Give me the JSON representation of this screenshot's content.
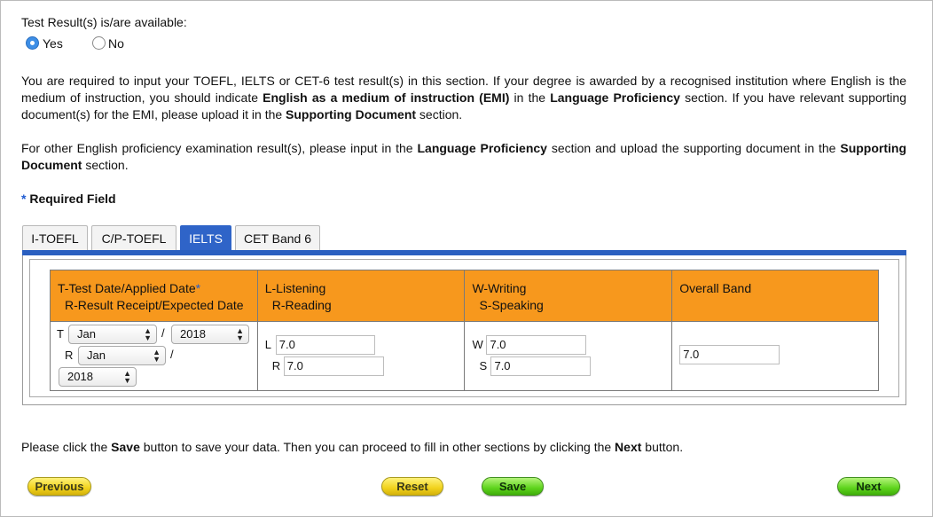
{
  "test_result": {
    "question": "Test Result(s) is/are available:",
    "options": [
      {
        "label": "Yes",
        "checked": true
      },
      {
        "label": "No",
        "checked": false
      }
    ]
  },
  "instructions": {
    "p1": [
      {
        "text": "You are required to input your TOEFL, IELTS or CET-6 test result(s) in this section. If your degree is awarded by a recognised institution where English is the medium of instruction, you should indicate ",
        "bold": false
      },
      {
        "text": "English as a medium of instruction (EMI)",
        "bold": true
      },
      {
        "text": " in the ",
        "bold": false
      },
      {
        "text": "Language Proficiency",
        "bold": true
      },
      {
        "text": " section. If you have relevant supporting document(s) for the EMI, please upload it in the ",
        "bold": false
      },
      {
        "text": "Supporting Document",
        "bold": true
      },
      {
        "text": " section.",
        "bold": false
      }
    ],
    "p2": [
      {
        "text": "For other English proficiency examination result(s), please input in the ",
        "bold": false
      },
      {
        "text": "Language Proficiency",
        "bold": true
      },
      {
        "text": " section and upload the supporting document in the ",
        "bold": false
      },
      {
        "text": "Supporting Document",
        "bold": true
      },
      {
        "text": " section.",
        "bold": false
      }
    ]
  },
  "required": {
    "star": "*",
    "label": "Required Field"
  },
  "tabs": [
    {
      "label": "I-TOEFL",
      "active": false
    },
    {
      "label": "C/P-TOEFL",
      "active": false
    },
    {
      "label": "IELTS",
      "active": true
    },
    {
      "label": "CET Band 6",
      "active": false
    }
  ],
  "table": {
    "headers": {
      "date": {
        "line1": "T-Test Date/Applied Date",
        "star": "*",
        "line2": "R-Result Receipt/Expected Date"
      },
      "lr": {
        "line1": "L-Listening",
        "line2": "R-Reading"
      },
      "ws": {
        "line1": "W-Writing",
        "line2": "S-Speaking"
      },
      "overall": {
        "line1": "Overall Band"
      }
    },
    "row": {
      "t_label": "T",
      "t_month": "Jan",
      "sep1": "/",
      "t_year": "2018",
      "r_label": "R",
      "r_month": "Jan",
      "sep2": "/",
      "r_year": "2018",
      "l_label": "L",
      "l_value": "7.0",
      "r2_label": "R",
      "r_value": "7.0",
      "w_label": "W",
      "w_value": "7.0",
      "s_label": "S",
      "s_value": "7.0",
      "overall_value": "7.0"
    }
  },
  "footer": [
    {
      "text": "Please click the ",
      "bold": false
    },
    {
      "text": "Save",
      "bold": true
    },
    {
      "text": " button to save your data. Then you can proceed to fill in other sections by clicking the ",
      "bold": false
    },
    {
      "text": "Next",
      "bold": true
    },
    {
      "text": " button.",
      "bold": false
    }
  ],
  "buttons": {
    "previous": "Previous",
    "reset": "Reset",
    "save": "Save",
    "next": "Next"
  },
  "colors": {
    "accent_blue": "#2f64c8",
    "header_orange": "#f7981d",
    "button_yellow": "#f1d21c",
    "button_green": "#5ed41c"
  }
}
